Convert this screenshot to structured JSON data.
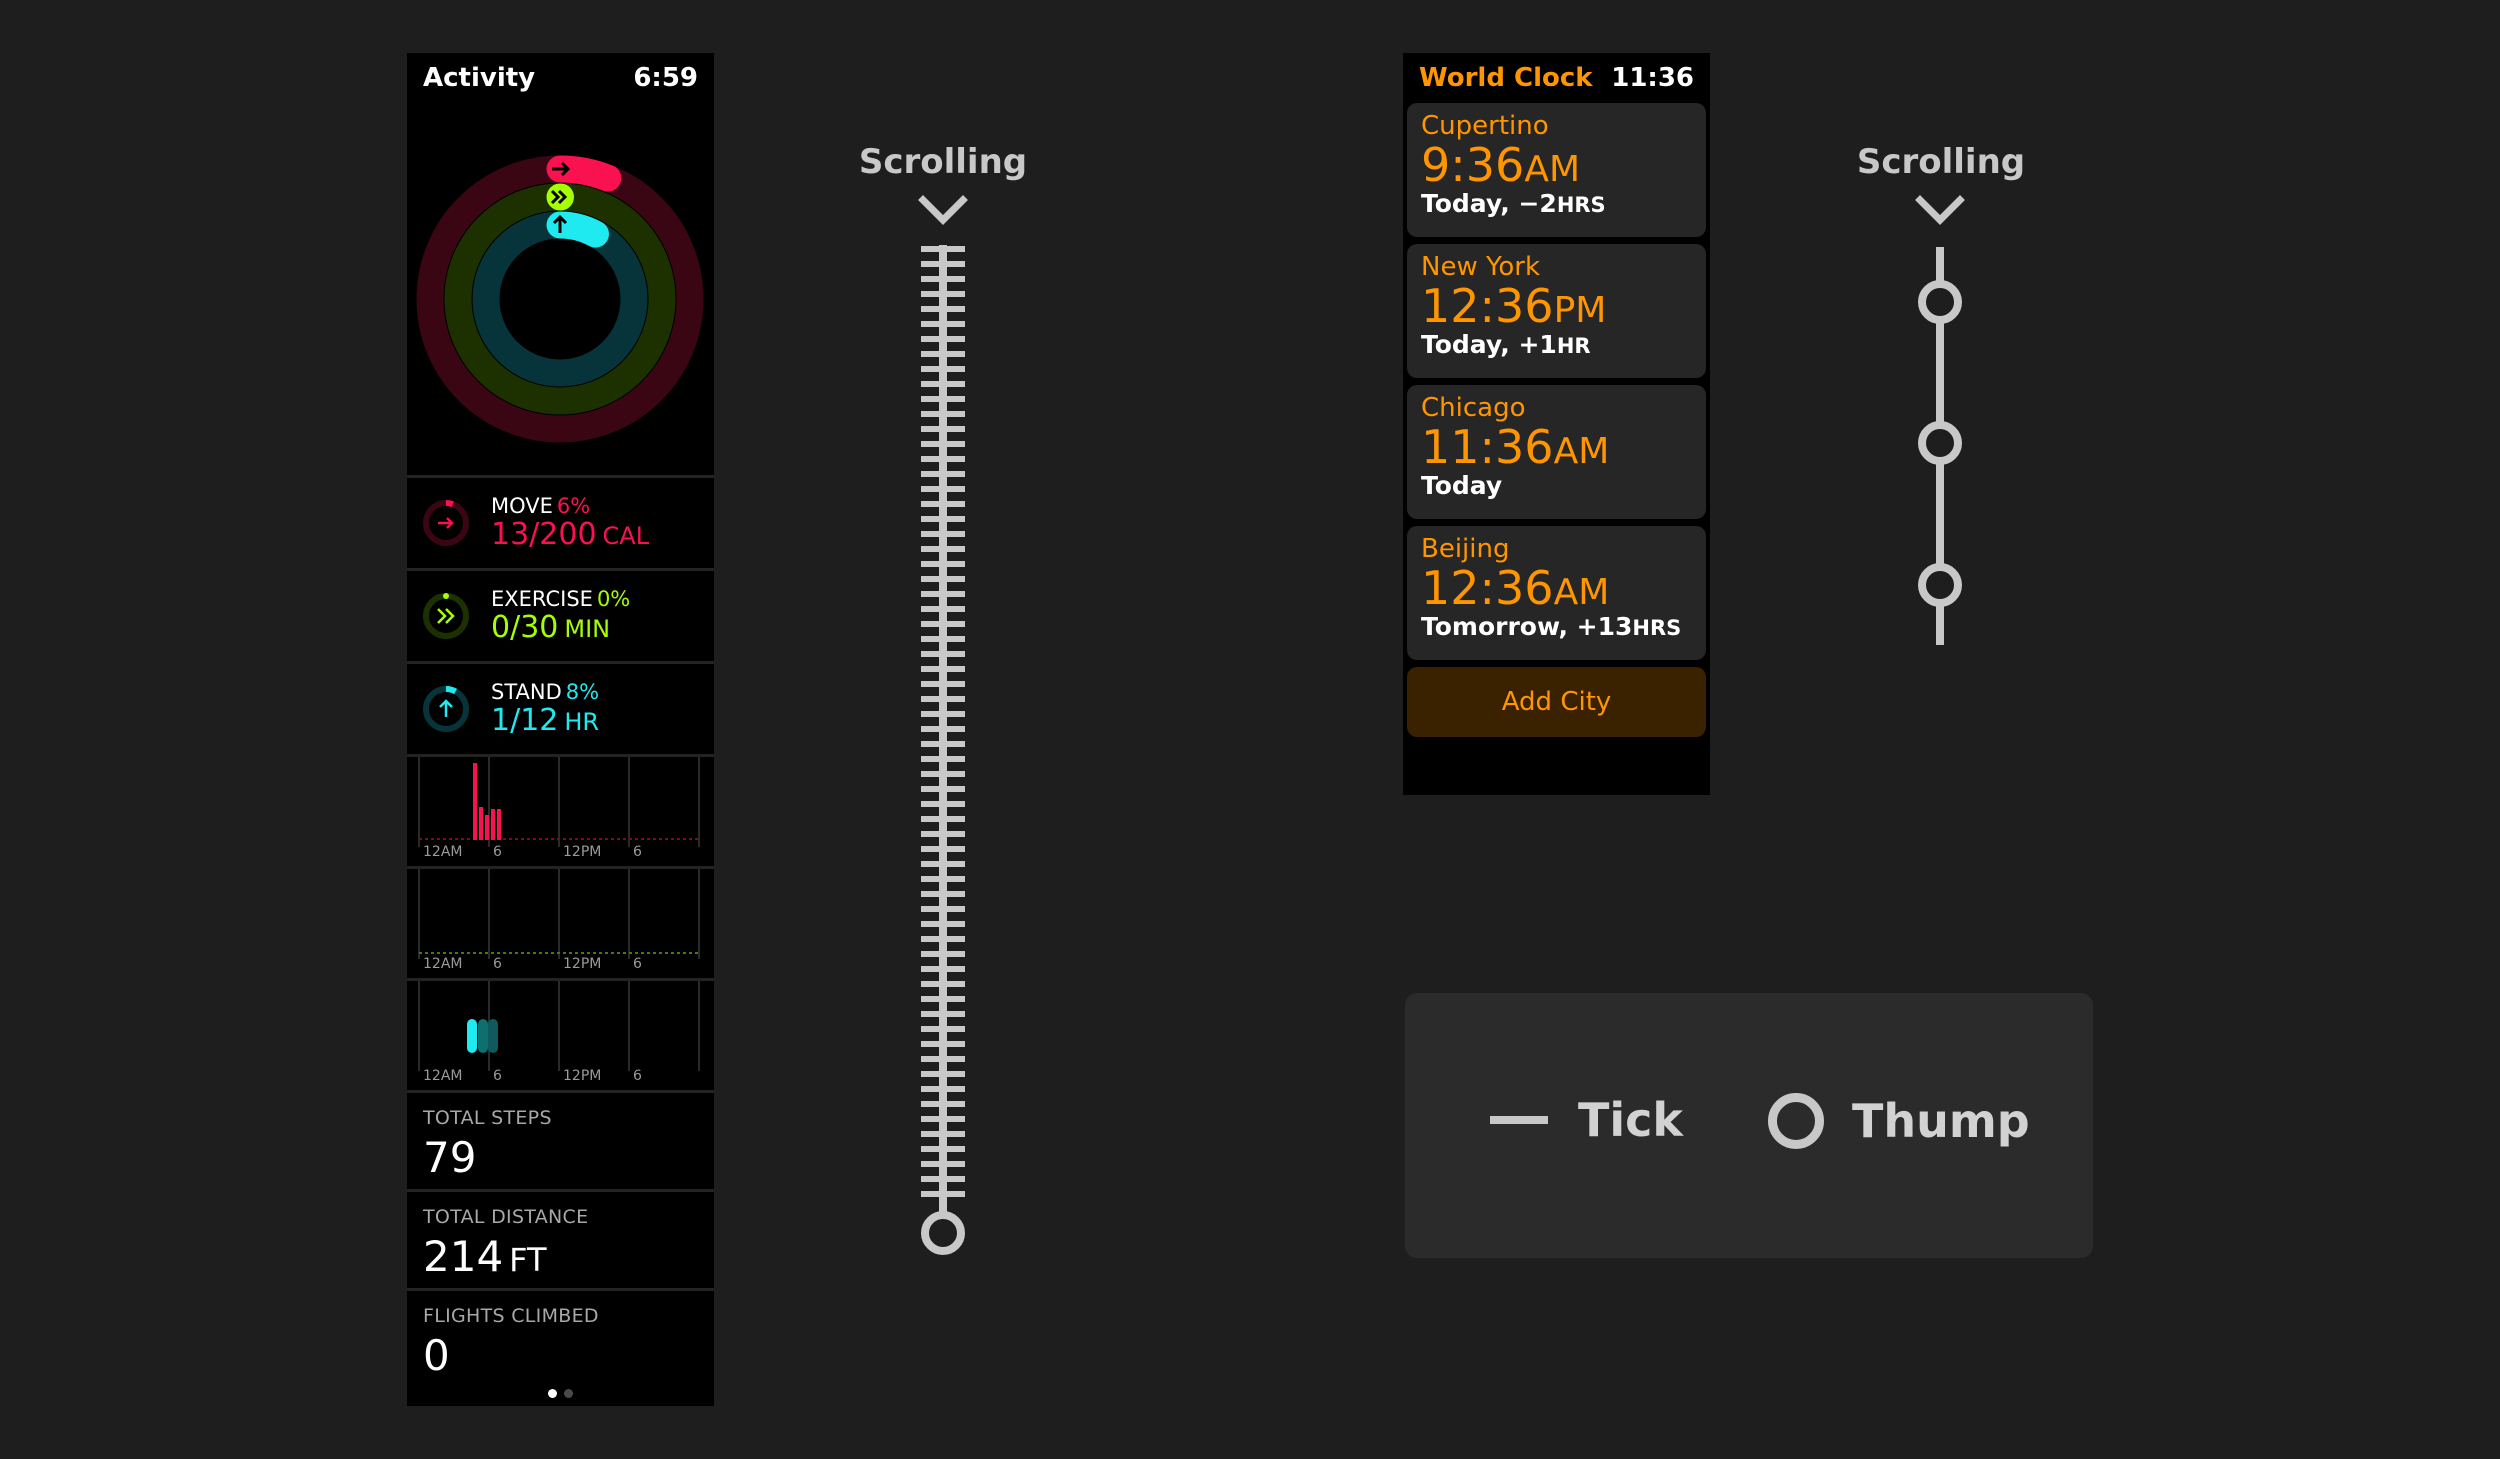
{
  "activity": {
    "app_title": "Activity",
    "time": "6:59",
    "metrics": [
      {
        "title": "MOVE",
        "percent": "6%",
        "value": "13/200",
        "unit": "CAL",
        "color": "#fa114f"
      },
      {
        "title": "EXERCISE",
        "percent": "0%",
        "value": "0/30",
        "unit": "MIN",
        "color": "#a6ff00"
      },
      {
        "title": "STAND",
        "percent": "8%",
        "value": "1/12",
        "unit": "HR",
        "color": "#1eeaef"
      }
    ],
    "graph_ticks": [
      "12AM",
      "6",
      "12PM",
      "6"
    ],
    "stats": [
      {
        "label": "TOTAL STEPS",
        "value": "79",
        "unit": ""
      },
      {
        "label": "TOTAL DISTANCE",
        "value": "214",
        "unit": "FT"
      },
      {
        "label": "FLIGHTS CLIMBED",
        "value": "0",
        "unit": ""
      }
    ],
    "page_dots": 2,
    "active_page": 1
  },
  "scroll_labels": [
    "Scrolling",
    "Scrolling"
  ],
  "world_clock": {
    "app_title": "World Clock",
    "time": "11:36",
    "cities": [
      {
        "name": "Cupertino",
        "time": "9:36",
        "ampm": "AM",
        "relative": "Today, −2",
        "rel_unit": "HRS"
      },
      {
        "name": "New York",
        "time": "12:36",
        "ampm": "PM",
        "relative": "Today, +1",
        "rel_unit": "HR"
      },
      {
        "name": "Chicago",
        "time": "11:36",
        "ampm": "AM",
        "relative": "Today",
        "rel_unit": ""
      },
      {
        "name": "Beijing",
        "time": "12:36",
        "ampm": "AM",
        "relative": "Tomorrow, +13",
        "rel_unit": "HRS"
      }
    ],
    "add_city_label": "Add City"
  },
  "legend": {
    "tick_label": "Tick",
    "thump_label": "Thump"
  },
  "colors": {
    "move": "#fa114f",
    "exercise": "#a6ff00",
    "stand": "#1eeaef",
    "clock_accent": "#ff9500",
    "guide": "#c8c8c8"
  }
}
